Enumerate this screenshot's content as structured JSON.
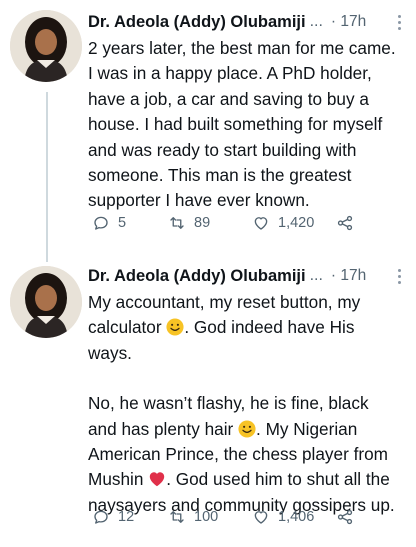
{
  "tweets": [
    {
      "author": "Dr. Adeola (Addy) Olubamiji",
      "ellipsis": "...",
      "time": "· 17h",
      "paragraphs": [
        [
          "2 years later, the best man for me came.",
          "I was in a happy place. A PhD holder,",
          "have a job, a car and saving to buy a",
          "house. I had built something for myself",
          "and was ready to start building with",
          "someone. This man is the greatest",
          "supporter I have ever known."
        ]
      ],
      "replies": "5",
      "retweets": "89",
      "likes": "1,420"
    },
    {
      "author": "Dr. Adeola (Addy) Olubamiji",
      "ellipsis": "...",
      "time": "· 17h",
      "p1_line1": "My accountant, my reset button, my",
      "p1_line2_pre": "calculator",
      "p1_line2_post": ". God indeed have His",
      "p1_line3": "ways.",
      "p2_line1": "No, he wasn’t flashy, he is fine, black",
      "p2_line2_pre": "and has plenty hair",
      "p2_line2_post": ". My Nigerian",
      "p2_line3": "American Prince, the chess player from",
      "p2_line4_pre": "Mushin",
      "p2_line4_post": ". God used him to shut all the",
      "p2_line5": "naysayers and community gossipers up.",
      "replies": "12",
      "retweets": "100",
      "likes": "1,406"
    }
  ],
  "icons": [
    "reply-icon",
    "retweet-icon",
    "like-icon",
    "share-icon",
    "more-icon",
    "smiley-emoji",
    "heart-emoji"
  ],
  "colors": {
    "text": "#0f1419",
    "muted": "#536471",
    "thread_line": "#cfd9de",
    "emoji_yellow": "#f7c325",
    "heart_red": "#e0304a"
  }
}
